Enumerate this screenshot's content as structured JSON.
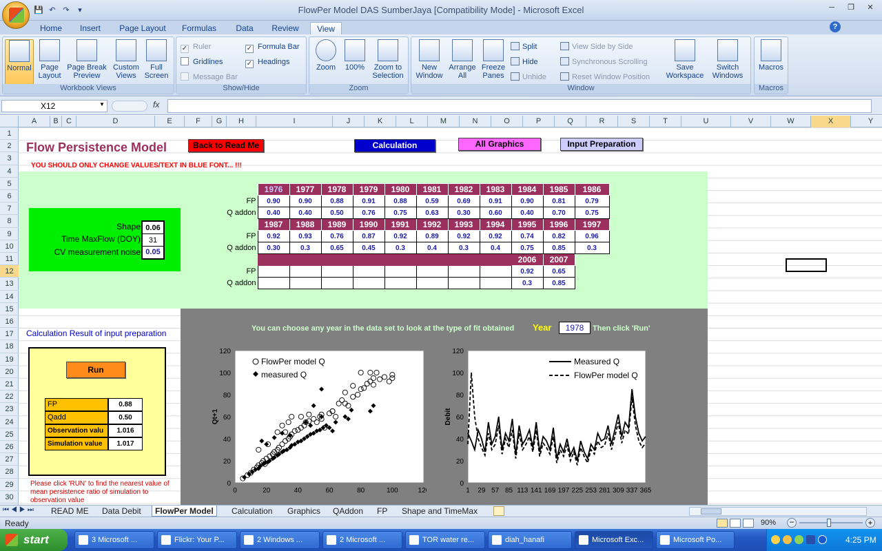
{
  "window": {
    "title": "FlowPer Model DAS SumberJaya  [Compatibility Mode] - Microsoft Excel",
    "controls": [
      "─",
      "❐",
      "✕"
    ]
  },
  "ribbon_tabs": [
    "Home",
    "Insert",
    "Page Layout",
    "Formulas",
    "Data",
    "Review",
    "View"
  ],
  "active_tab": "View",
  "ribbon": {
    "workbook_views": {
      "label": "Workbook Views",
      "normal": "Normal",
      "page_layout": "Page Layout",
      "page_break": "Page Break Preview",
      "custom_views": "Custom Views",
      "full_screen": "Full Screen"
    },
    "show_hide": {
      "label": "Show/Hide",
      "ruler": "Ruler",
      "gridlines": "Gridlines",
      "message_bar": "Message Bar",
      "formula_bar": "Formula Bar",
      "headings": "Headings"
    },
    "zoom": {
      "label": "Zoom",
      "zoom": "Zoom",
      "zoom100": "100%",
      "zoom_selection": "Zoom to Selection"
    },
    "window": {
      "label": "Window",
      "new_window": "New Window",
      "arrange_all": "Arrange All",
      "freeze_panes": "Freeze Panes",
      "split": "Split",
      "hide": "Hide",
      "unhide": "Unhide",
      "side_by_side": "View Side by Side",
      "sync_scroll": "Synchronous Scrolling",
      "reset_pos": "Reset Window Position",
      "save_workspace": "Save Workspace",
      "switch_windows": "Switch Windows"
    },
    "macros": {
      "label": "Macros",
      "macros": "Macros"
    }
  },
  "formula_bar": {
    "name_box": "X12",
    "fx": "fx",
    "value": ""
  },
  "columns": [
    "A",
    "B",
    "C",
    "D",
    "E",
    "F",
    "G",
    "H",
    "I",
    "J",
    "K",
    "L",
    "M",
    "N",
    "O",
    "P",
    "Q",
    "R",
    "S",
    "T",
    "U",
    "V",
    "W",
    "X",
    "Y"
  ],
  "rows": [
    "1",
    "2",
    "3",
    "4",
    "5",
    "6",
    "7",
    "8",
    "9",
    "10",
    "11",
    "12",
    "13",
    "14",
    "15",
    "16",
    "17",
    "18",
    "19",
    "20",
    "21",
    "22",
    "23",
    "24",
    "25",
    "26",
    "27",
    "28",
    "29",
    "30"
  ],
  "sheet": {
    "title": "Flow Persistence Model",
    "warning": "YOU SHOULD ONLY CHANGE VALUES/TEXT IN BLUE FONT... !!!",
    "buttons": {
      "back": "Back to Read Me",
      "calc": "Calculation",
      "graphics": "All Graphics",
      "input": "Input Preparation",
      "run": "Run"
    },
    "params": {
      "shape_label": "Shape",
      "shape": "0.06",
      "tmax_label": "Time MaxFlow (DOY)",
      "tmax": "31",
      "cv_label": "CV measurement noise",
      "cv": "0.05"
    },
    "fp_label": "FP",
    "qaddon_label": "Q addon",
    "block1": {
      "years": [
        "1976",
        "1977",
        "1978",
        "1979",
        "1980",
        "1981",
        "1982",
        "1983",
        "1984",
        "1985",
        "1986"
      ],
      "fp": [
        "0.90",
        "0.90",
        "0.88",
        "0.91",
        "0.88",
        "0.59",
        "0.69",
        "0.91",
        "0.90",
        "0.81",
        "0.79"
      ],
      "q": [
        "0.40",
        "0.40",
        "0.50",
        "0.76",
        "0.75",
        "0.63",
        "0.30",
        "0.60",
        "0.40",
        "0.70",
        "0.75"
      ]
    },
    "block2": {
      "years": [
        "1987",
        "1988",
        "1989",
        "1990",
        "1991",
        "1992",
        "1993",
        "1994",
        "1995",
        "1996",
        "1997"
      ],
      "fp": [
        "0.92",
        "0.93",
        "0.76",
        "0.87",
        "0.92",
        "0.89",
        "0.92",
        "0.92",
        "0.74",
        "0.82",
        "0.96"
      ],
      "q": [
        "0.30",
        "0.3",
        "0.65",
        "0.45",
        "0.3",
        "0.4",
        "0.3",
        "0.4",
        "0.75",
        "0.85",
        "0.3"
      ]
    },
    "block3": {
      "years": [
        "2006",
        "2007"
      ],
      "fp": [
        "0.92",
        "0.65"
      ],
      "q": [
        "0.3",
        "0.85"
      ]
    },
    "calc_title": "Calculation Result of input  preparation",
    "results": {
      "fp_label": "FP",
      "fp": "0.88",
      "qadd_label": "Qadd",
      "qadd": "0.50",
      "obs_label": "Observation valu",
      "obs": "1.016",
      "sim_label": "Simulation value",
      "sim": "1.017"
    },
    "note": "Please click 'RUN' to find the nearest value of mean persistence ratio of simulation to observation value",
    "choose_text": "You can choose any year in the data set to look at the type of fit obtained",
    "year_label": "Year",
    "year_value": "1978",
    "then_text": "Then click 'Run'"
  },
  "chart_data": [
    {
      "type": "scatter",
      "title": "",
      "xlabel": "",
      "ylabel": "Qt+1",
      "xlim": [
        0,
        120
      ],
      "ylim": [
        0,
        120
      ],
      "xticks": [
        "0",
        "20",
        "40",
        "60",
        "80",
        "100",
        "120"
      ],
      "yticks": [
        "0",
        "20",
        "40",
        "60",
        "80",
        "100",
        "120"
      ],
      "legend_position": "top-left",
      "series": [
        {
          "name": "FlowPer model Q",
          "marker": "open-circle",
          "points": [
            [
              5,
              4
            ],
            [
              8,
              7
            ],
            [
              10,
              9
            ],
            [
              12,
              12
            ],
            [
              14,
              14
            ],
            [
              15,
              16
            ],
            [
              17,
              18
            ],
            [
              18,
              20
            ],
            [
              19,
              17
            ],
            [
              20,
              22
            ],
            [
              22,
              24
            ],
            [
              24,
              26
            ],
            [
              25,
              28
            ],
            [
              27,
              30
            ],
            [
              28,
              32
            ],
            [
              30,
              35
            ],
            [
              32,
              38
            ],
            [
              34,
              40
            ],
            [
              35,
              42
            ],
            [
              36,
              44
            ],
            [
              38,
              47
            ],
            [
              40,
              48
            ],
            [
              42,
              50
            ],
            [
              44,
              52
            ],
            [
              45,
              55
            ],
            [
              47,
              56
            ],
            [
              50,
              58
            ],
            [
              52,
              55
            ],
            [
              54,
              60
            ],
            [
              55,
              62
            ],
            [
              57,
              50
            ],
            [
              60,
              63
            ],
            [
              62,
              65
            ],
            [
              64,
              60
            ],
            [
              66,
              72
            ],
            [
              68,
              75
            ],
            [
              70,
              72
            ],
            [
              72,
              70
            ],
            [
              75,
              78
            ],
            [
              78,
              80
            ],
            [
              80,
              85
            ],
            [
              82,
              86
            ],
            [
              84,
              90
            ],
            [
              86,
              92
            ],
            [
              88,
              89
            ],
            [
              90,
              100
            ],
            [
              92,
              94
            ],
            [
              95,
              96
            ],
            [
              98,
              92
            ],
            [
              100,
              98
            ],
            [
              100,
              95
            ],
            [
              30,
              52
            ],
            [
              34,
              55
            ],
            [
              27,
              46
            ],
            [
              36,
              60
            ],
            [
              21,
              35
            ],
            [
              42,
              60
            ],
            [
              15,
              30
            ],
            [
              32,
              46
            ],
            [
              47,
              62
            ],
            [
              55,
              58
            ],
            [
              62,
              65
            ],
            [
              70,
              82
            ],
            [
              75,
              88
            ],
            [
              88,
              95
            ],
            [
              86,
              100
            ],
            [
              80,
              100
            ]
          ]
        },
        {
          "name": "measured Q",
          "marker": "filled-diamond",
          "points": [
            [
              6,
              5
            ],
            [
              9,
              8
            ],
            [
              11,
              10
            ],
            [
              13,
              12
            ],
            [
              15,
              13
            ],
            [
              16,
              15
            ],
            [
              18,
              17
            ],
            [
              19,
              18
            ],
            [
              21,
              19
            ],
            [
              22,
              20
            ],
            [
              24,
              22
            ],
            [
              25,
              23
            ],
            [
              27,
              25
            ],
            [
              28,
              26
            ],
            [
              30,
              28
            ],
            [
              31,
              29
            ],
            [
              33,
              30
            ],
            [
              35,
              32
            ],
            [
              36,
              34
            ],
            [
              38,
              35
            ],
            [
              40,
              37
            ],
            [
              42,
              38
            ],
            [
              44,
              40
            ],
            [
              46,
              42
            ],
            [
              48,
              44
            ],
            [
              50,
              45
            ],
            [
              52,
              47
            ],
            [
              54,
              48
            ],
            [
              56,
              50
            ],
            [
              58,
              52
            ],
            [
              17,
              38
            ],
            [
              25,
              41
            ],
            [
              30,
              45
            ],
            [
              35,
              43
            ],
            [
              20,
              35
            ],
            [
              48,
              52
            ],
            [
              55,
              60
            ],
            [
              50,
              70
            ],
            [
              55,
              85
            ],
            [
              60,
              50
            ],
            [
              62,
              47
            ],
            [
              64,
              55
            ],
            [
              70,
              60
            ],
            [
              72,
              58
            ],
            [
              74,
              66
            ],
            [
              86,
              65
            ],
            [
              88,
              70
            ],
            [
              45,
              55
            ]
          ]
        }
      ]
    },
    {
      "type": "line",
      "title": "",
      "xlabel": "",
      "ylabel": "Debit",
      "xlim": [
        1,
        365
      ],
      "ylim": [
        0,
        120
      ],
      "xticks": [
        "1",
        "29",
        "57",
        "85",
        "113",
        "141",
        "169",
        "197",
        "225",
        "253",
        "281",
        "309",
        "337",
        "365"
      ],
      "yticks": [
        "0",
        "20",
        "40",
        "60",
        "80",
        "100",
        "120"
      ],
      "legend_position": "top-right",
      "series": [
        {
          "name": "Measured Q",
          "style": "solid",
          "x": [
            1,
            8,
            15,
            22,
            29,
            36,
            43,
            50,
            57,
            64,
            71,
            78,
            85,
            92,
            99,
            106,
            113,
            120,
            127,
            134,
            141,
            148,
            155,
            162,
            169,
            176,
            183,
            190,
            197,
            204,
            211,
            218,
            225,
            232,
            239,
            246,
            253,
            260,
            267,
            274,
            281,
            288,
            295,
            302,
            309,
            316,
            323,
            330,
            337,
            344,
            351,
            358,
            365
          ],
          "y": [
            45,
            38,
            30,
            48,
            40,
            28,
            55,
            35,
            42,
            60,
            30,
            45,
            38,
            58,
            25,
            52,
            35,
            40,
            48,
            32,
            55,
            28,
            42,
            38,
            30,
            50,
            22,
            35,
            28,
            40,
            25,
            32,
            20,
            38,
            28,
            22,
            35,
            30,
            45,
            38,
            40,
            52,
            35,
            48,
            62,
            42,
            55,
            50,
            85,
            60,
            45,
            38,
            42
          ]
        },
        {
          "name": "FlowPer model Q",
          "style": "dashed",
          "x": [
            1,
            8,
            15,
            22,
            29,
            36,
            43,
            50,
            57,
            64,
            71,
            78,
            85,
            92,
            99,
            106,
            113,
            120,
            127,
            134,
            141,
            148,
            155,
            162,
            169,
            176,
            183,
            190,
            197,
            204,
            211,
            218,
            225,
            232,
            239,
            246,
            253,
            260,
            267,
            274,
            281,
            288,
            295,
            302,
            309,
            316,
            323,
            330,
            337,
            344,
            351,
            358,
            365
          ],
          "y": [
            35,
            100,
            60,
            40,
            32,
            25,
            45,
            30,
            35,
            52,
            26,
            40,
            32,
            48,
            22,
            45,
            30,
            35,
            42,
            28,
            48,
            24,
            36,
            32,
            26,
            42,
            18,
            30,
            24,
            34,
            20,
            28,
            16,
            32,
            24,
            18,
            30,
            26,
            38,
            32,
            34,
            45,
            30,
            42,
            55,
            36,
            48,
            44,
            78,
            52,
            38,
            32,
            36
          ]
        }
      ]
    }
  ],
  "sheet_tabs": [
    "READ ME",
    "Data Debit",
    "FlowPer Model",
    "Calculation",
    "Graphics",
    "QAddon",
    "FP",
    "Shape and TimeMax"
  ],
  "active_sheet": "FlowPer Model",
  "status": {
    "ready": "Ready",
    "zoom": "90%"
  },
  "taskbar": {
    "start": "start",
    "items": [
      "3 Microsoft ...",
      "Flickr: Your P...",
      "2 Windows ...",
      "2 Microsoft ...",
      "TOR water re...",
      "diah_hanafi",
      "Microsoft Exc...",
      "Microsoft Po..."
    ],
    "clock": "4:25 PM"
  }
}
